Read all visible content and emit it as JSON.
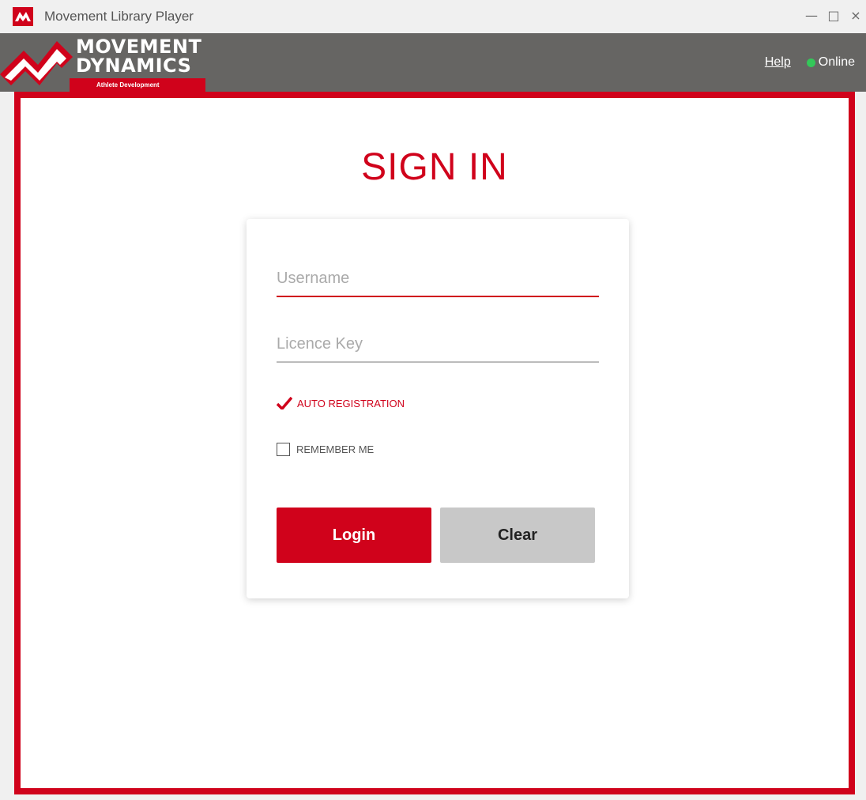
{
  "window": {
    "title": "Movement Library Player",
    "controls": {
      "minimize": "—",
      "maximize": "□",
      "close": "×"
    }
  },
  "header": {
    "brand_line1": "MOVEMENT",
    "brand_line2": "DYNAMICS",
    "tagline": "Athlete Development",
    "help_label": "Help",
    "status_label": "Online",
    "status_color": "#34c759"
  },
  "signin": {
    "title": "SIGN IN",
    "username_placeholder": "Username",
    "username_value": "",
    "licence_placeholder": "Licence Key",
    "licence_value": "",
    "auto_registration_label": "AUTO REGISTRATION",
    "auto_registration_checked": true,
    "remember_label": "REMEMBER ME",
    "remember_checked": false,
    "login_label": "Login",
    "clear_label": "Clear"
  },
  "colors": {
    "accent": "#d0021b",
    "header_bg": "#666563",
    "clear_button": "#c8c8c8"
  },
  "icons": {
    "app": "movement-dynamics-logo-icon",
    "auto_registration": "checkmark-icon",
    "remember": "checkbox-empty-icon"
  }
}
